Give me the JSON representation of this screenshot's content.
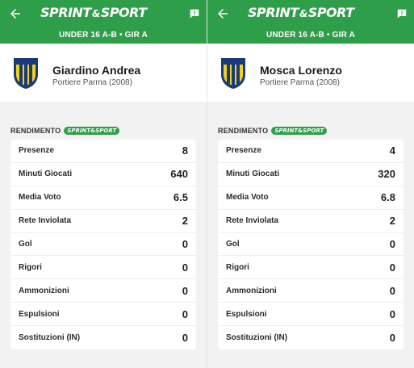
{
  "brand": {
    "logo_left": "SPRINT",
    "logo_amp": "&",
    "logo_right": "SPORT",
    "accent": "#2e9e4a"
  },
  "league": "UNDER 16 A-B • GIR A",
  "section_label": "RENDIMENTO",
  "section_badge": "SPRINT&SPORT",
  "players": [
    {
      "name": "Giardino Andrea",
      "role": "Portiere Parma (2008)",
      "stats": [
        {
          "label": "Presenze",
          "value": "8"
        },
        {
          "label": "Minuti Giocati",
          "value": "640"
        },
        {
          "label": "Media Voto",
          "value": "6.5"
        },
        {
          "label": "Rete Inviolata",
          "value": "2"
        },
        {
          "label": "Gol",
          "value": "0"
        },
        {
          "label": "Rigori",
          "value": "0"
        },
        {
          "label": "Ammonizioni",
          "value": "0"
        },
        {
          "label": "Espulsioni",
          "value": "0"
        },
        {
          "label": "Sostituzioni (IN)",
          "value": "0"
        }
      ]
    },
    {
      "name": "Mosca Lorenzo",
      "role": "Portiere Parma (2008)",
      "stats": [
        {
          "label": "Presenze",
          "value": "4"
        },
        {
          "label": "Minuti Giocati",
          "value": "320"
        },
        {
          "label": "Media Voto",
          "value": "6.8"
        },
        {
          "label": "Rete Inviolata",
          "value": "2"
        },
        {
          "label": "Gol",
          "value": "0"
        },
        {
          "label": "Rigori",
          "value": "0"
        },
        {
          "label": "Ammonizioni",
          "value": "0"
        },
        {
          "label": "Espulsioni",
          "value": "0"
        },
        {
          "label": "Sostituzioni (IN)",
          "value": "0"
        }
      ]
    }
  ],
  "icons": {
    "back": "back-arrow-icon",
    "alert": "alert-message-icon",
    "crest": "parma-calcio-crest-icon"
  }
}
